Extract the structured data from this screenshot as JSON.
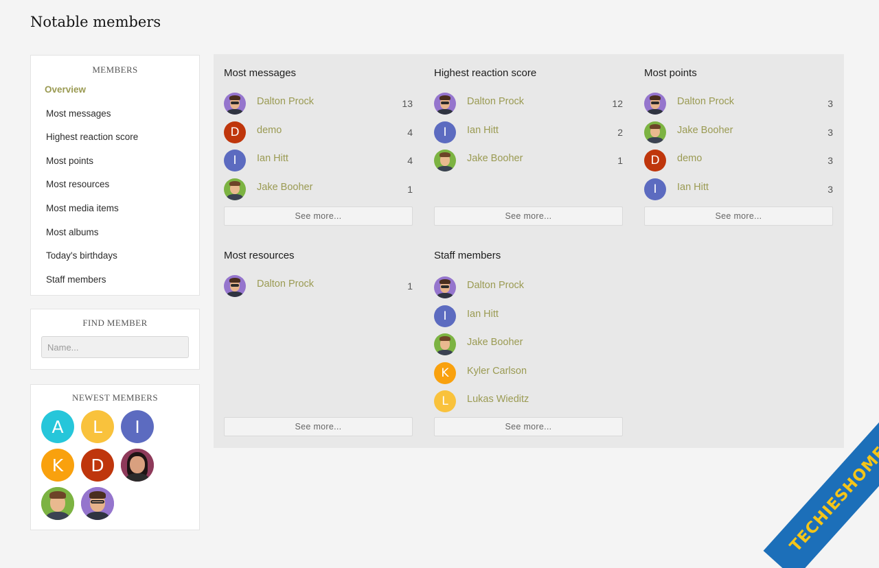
{
  "page": {
    "title": "Notable members"
  },
  "sidebar": {
    "members": {
      "title": "MEMBERS",
      "items": [
        {
          "label": "Overview",
          "active": true
        },
        {
          "label": "Most messages"
        },
        {
          "label": "Highest reaction score"
        },
        {
          "label": "Most points"
        },
        {
          "label": "Most resources"
        },
        {
          "label": "Most media items"
        },
        {
          "label": "Most albums"
        },
        {
          "label": "Today's birthdays"
        },
        {
          "label": "Staff members"
        }
      ]
    },
    "find_member": {
      "title": "FIND MEMBER",
      "placeholder": "Name..."
    },
    "newest_members": {
      "title": "NEWEST MEMBERS",
      "avatars": [
        {
          "letter": "A",
          "color": "#26c6da"
        },
        {
          "letter": "L",
          "color": "#f9c23c"
        },
        {
          "letter": "I",
          "color": "#5c6bc0"
        },
        {
          "letter": "K",
          "color": "#f9a10e"
        },
        {
          "letter": "D",
          "color": "#bf360c"
        },
        {
          "letter": "",
          "color": "#8e3a5a",
          "icon": "woman-photo-avatar"
        },
        {
          "letter": "",
          "color": "#7cb342",
          "icon": "jake-photo-avatar"
        },
        {
          "letter": "",
          "color": "#9575cd",
          "icon": "dalton-photo-avatar"
        }
      ]
    }
  },
  "sections": [
    {
      "title": "Most messages",
      "members": [
        {
          "name": "Dalton Prock",
          "count": "13",
          "avatar": "dalton"
        },
        {
          "name": "demo",
          "count": "4",
          "avatar": "D",
          "color": "#bf360c"
        },
        {
          "name": "Ian Hitt",
          "count": "4",
          "avatar": "I",
          "color": "#5c6bc0"
        },
        {
          "name": "Jake Booher",
          "count": "1",
          "avatar": "jake"
        }
      ],
      "see_more": "See more..."
    },
    {
      "title": "Highest reaction score",
      "members": [
        {
          "name": "Dalton Prock",
          "count": "12",
          "avatar": "dalton"
        },
        {
          "name": "Ian Hitt",
          "count": "2",
          "avatar": "I",
          "color": "#5c6bc0"
        },
        {
          "name": "Jake Booher",
          "count": "1",
          "avatar": "jake"
        }
      ],
      "see_more": "See more..."
    },
    {
      "title": "Most points",
      "members": [
        {
          "name": "Dalton Prock",
          "count": "3",
          "avatar": "dalton"
        },
        {
          "name": "Jake Booher",
          "count": "3",
          "avatar": "jake"
        },
        {
          "name": "demo",
          "count": "3",
          "avatar": "D",
          "color": "#bf360c"
        },
        {
          "name": "Ian Hitt",
          "count": "3",
          "avatar": "I",
          "color": "#5c6bc0"
        }
      ],
      "see_more": "See more..."
    },
    {
      "title": "Most resources",
      "members": [
        {
          "name": "Dalton Prock",
          "count": "1",
          "avatar": "dalton"
        }
      ],
      "see_more": "See more..."
    },
    {
      "title": "Staff members",
      "members": [
        {
          "name": "Dalton Prock",
          "avatar": "dalton"
        },
        {
          "name": "Ian Hitt",
          "avatar": "I",
          "color": "#5c6bc0"
        },
        {
          "name": "Jake Booher",
          "avatar": "jake"
        },
        {
          "name": "Kyler Carlson",
          "avatar": "K",
          "color": "#f9a10e"
        },
        {
          "name": "Lukas Wieditz",
          "avatar": "L",
          "color": "#f9c23c"
        }
      ],
      "see_more": "See more..."
    }
  ],
  "watermark": {
    "text": "TECHIESHOME.COM"
  }
}
